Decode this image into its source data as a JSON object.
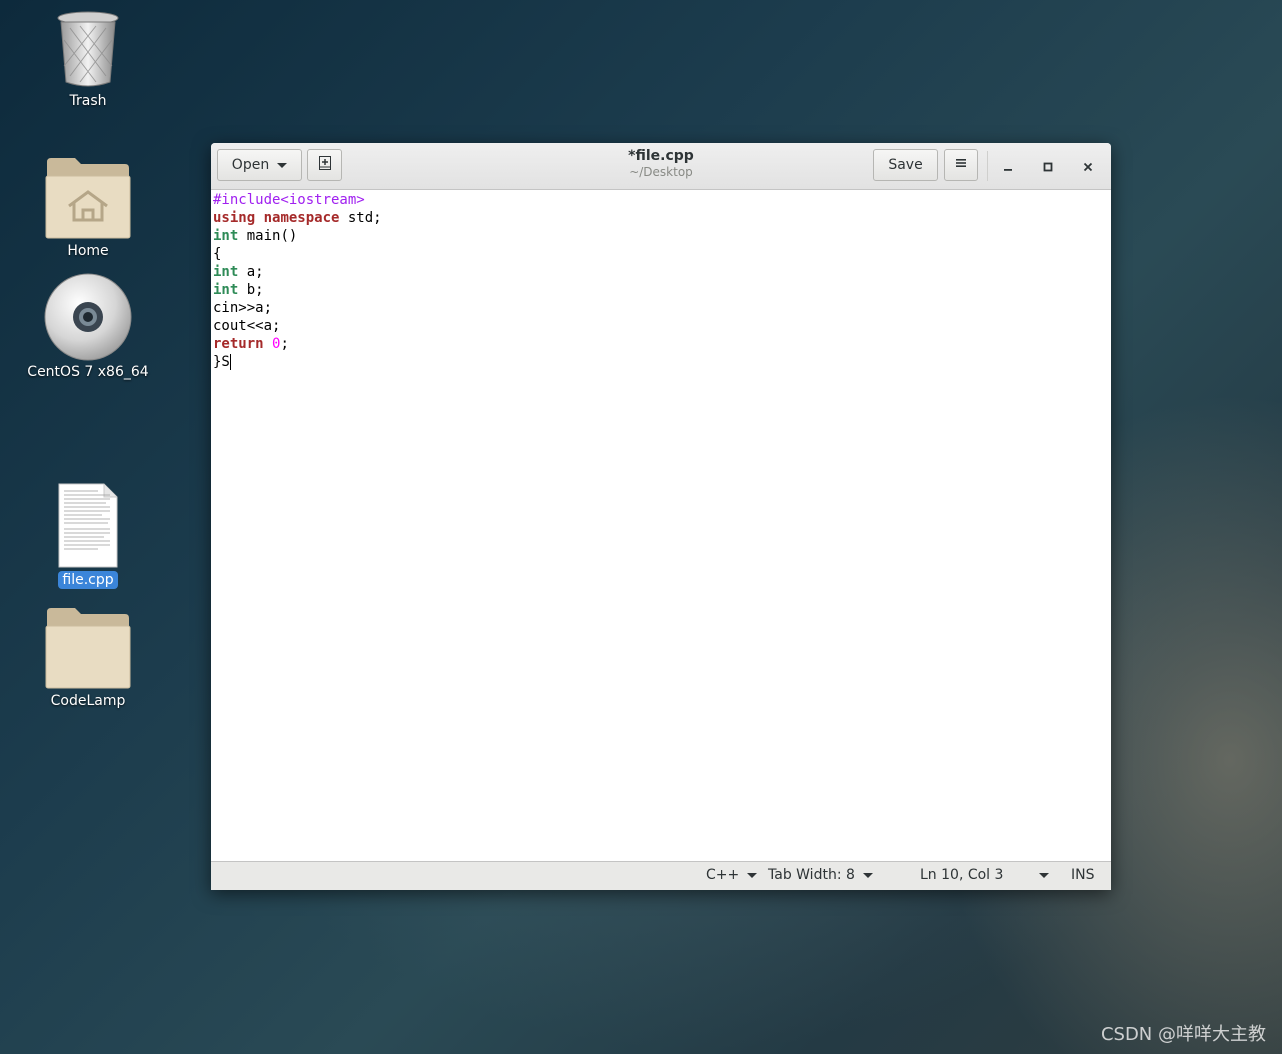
{
  "desktop": {
    "icons": [
      {
        "label": "Trash",
        "icon": "trash-icon"
      },
      {
        "label": "Home",
        "icon": "home-folder-icon"
      },
      {
        "label": "CentOS 7 x86_64",
        "icon": "cd-disc-icon"
      },
      {
        "label": "file.cpp",
        "icon": "text-file-icon",
        "selected": true
      },
      {
        "label": "CodeLamp",
        "icon": "folder-icon"
      }
    ]
  },
  "window": {
    "open_label": "Open",
    "title": "*file.cpp",
    "subtitle": "~/Desktop",
    "save_label": "Save",
    "icons": {
      "new_doc": "new-document-icon",
      "menu": "hamburger-menu-icon",
      "minimize": "minimize-icon",
      "maximize": "maximize-icon",
      "close": "close-icon"
    }
  },
  "editor": {
    "lines": [
      "#include<iostream>",
      "using namespace std;",
      "int main()",
      "{",
      "int a;",
      "int b;",
      "cin>>a;",
      "cout<<a;",
      "return 0;",
      "}S"
    ]
  },
  "statusbar": {
    "language": "C++",
    "tab_width": "Tab Width: 8",
    "position": "Ln 10, Col 3",
    "mode": "INS"
  },
  "watermark": "CSDN @咩咩大主教",
  "colors": {
    "preprocessor": "#a020f0",
    "keyword": "#a52a2a",
    "type": "#2e8b57",
    "number": "#ff00ff",
    "selection": "#3b85d9"
  }
}
